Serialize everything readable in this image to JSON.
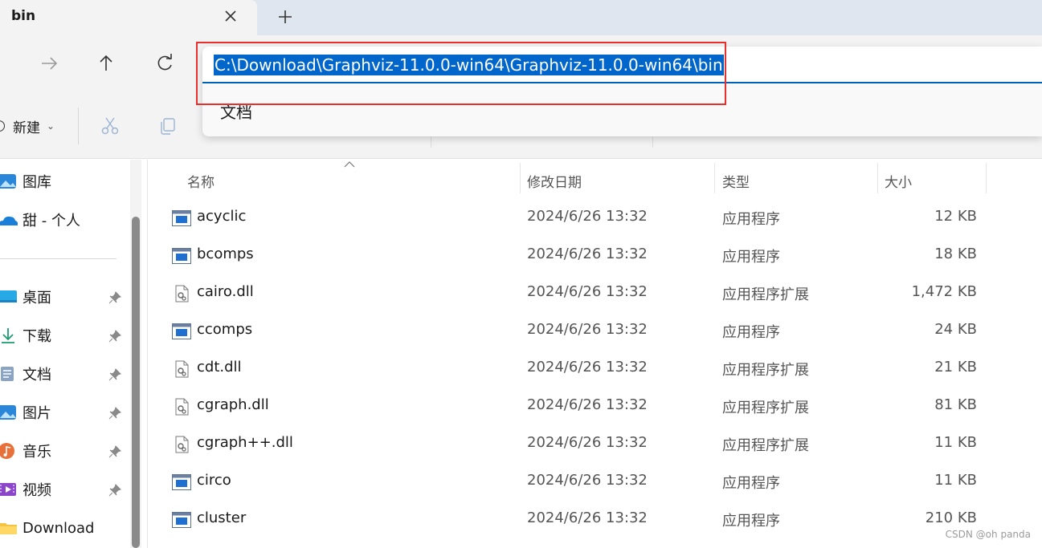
{
  "tab": {
    "title": "bin"
  },
  "address": {
    "path": "C:\\Download\\Graphviz-11.0.0-win64\\Graphviz-11.0.0-win64\\bin",
    "suggestion": "文档"
  },
  "toolbar": {
    "new_label": "新建"
  },
  "sidebar": {
    "items": [
      {
        "label": "图库",
        "icon": "gallery-icon"
      },
      {
        "label": "甜 - 个人",
        "icon": "onedrive-icon"
      },
      {
        "label": "桌面",
        "icon": "desktop-icon",
        "pinned": true
      },
      {
        "label": "下载",
        "icon": "download-icon",
        "pinned": true
      },
      {
        "label": "文档",
        "icon": "documents-icon",
        "pinned": true
      },
      {
        "label": "图片",
        "icon": "pictures-icon",
        "pinned": true
      },
      {
        "label": "音乐",
        "icon": "music-icon",
        "pinned": true
      },
      {
        "label": "视频",
        "icon": "videos-icon",
        "pinned": true
      },
      {
        "label": "Download",
        "icon": "folder-icon"
      }
    ]
  },
  "columns": {
    "name": "名称",
    "modified": "修改日期",
    "type": "类型",
    "size": "大小"
  },
  "files": [
    {
      "name": "acyclic",
      "date": "2024/6/26 13:32",
      "type": "应用程序",
      "size": "12 KB",
      "icon": "exe-icon"
    },
    {
      "name": "bcomps",
      "date": "2024/6/26 13:32",
      "type": "应用程序",
      "size": "18 KB",
      "icon": "exe-icon"
    },
    {
      "name": "cairo.dll",
      "date": "2024/6/26 13:32",
      "type": "应用程序扩展",
      "size": "1,472 KB",
      "icon": "dll-icon"
    },
    {
      "name": "ccomps",
      "date": "2024/6/26 13:32",
      "type": "应用程序",
      "size": "24 KB",
      "icon": "exe-icon"
    },
    {
      "name": "cdt.dll",
      "date": "2024/6/26 13:32",
      "type": "应用程序扩展",
      "size": "21 KB",
      "icon": "dll-icon"
    },
    {
      "name": "cgraph.dll",
      "date": "2024/6/26 13:32",
      "type": "应用程序扩展",
      "size": "81 KB",
      "icon": "dll-icon"
    },
    {
      "name": "cgraph++.dll",
      "date": "2024/6/26 13:32",
      "type": "应用程序扩展",
      "size": "11 KB",
      "icon": "dll-icon"
    },
    {
      "name": "circo",
      "date": "2024/6/26 13:32",
      "type": "应用程序",
      "size": "11 KB",
      "icon": "exe-icon"
    },
    {
      "name": "cluster",
      "date": "2024/6/26 13:32",
      "type": "应用程序",
      "size": "210 KB",
      "icon": "exe-icon"
    }
  ],
  "watermark": "CSDN @oh panda",
  "colors": {
    "accent": "#005fb8",
    "selection": "#0066cc",
    "highlight_box": "#e8312f"
  }
}
